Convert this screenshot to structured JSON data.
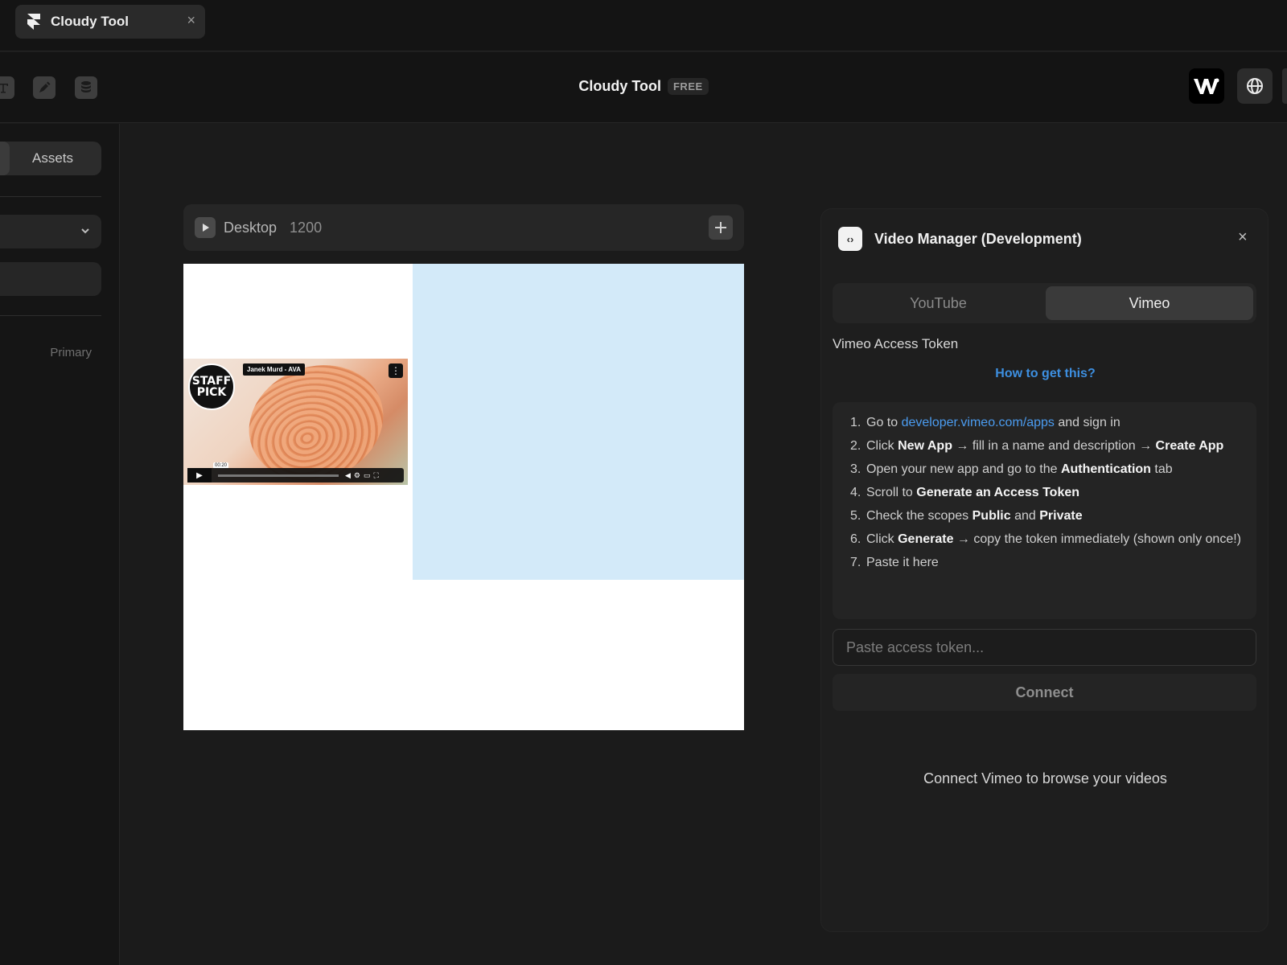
{
  "tab": {
    "title": "Cloudy Tool",
    "close_glyph": "×",
    "icon": "framer-logo-icon"
  },
  "toolbar": {
    "title": "Cloudy Tool",
    "plan_badge": "FREE",
    "tools": [
      "text-icon",
      "pen-tool-icon",
      "database-icon"
    ],
    "right_buttons": [
      "w-logo-icon",
      "globe-icon"
    ]
  },
  "sidebar": {
    "assets_tab": "Assets",
    "primary_label": "Primary"
  },
  "canvas": {
    "breakpoint_name": "Desktop",
    "breakpoint_width": "1200",
    "video": {
      "badge_text_line1": "STAFF",
      "badge_text_line2": "PICK",
      "title": "Janek Murd - AVA",
      "time": "00:20"
    },
    "colors": {
      "blue_box": "#d3eaf9",
      "frame": "#ffffff"
    }
  },
  "panel": {
    "title": "Video Manager (Development)",
    "close_glyph": "×",
    "tabs": [
      "YouTube",
      "Vimeo"
    ],
    "active_tab": "Vimeo",
    "token_label": "Vimeo Access Token",
    "howto_link": "How to get this?",
    "steps": [
      {
        "n": "1.",
        "parts": [
          [
            "t",
            "Go to "
          ],
          [
            "a",
            "developer.vimeo.com/apps"
          ],
          [
            "t",
            " and sign in"
          ]
        ]
      },
      {
        "n": "2.",
        "parts": [
          [
            "t",
            "Click "
          ],
          [
            "b",
            "New App"
          ],
          [
            "t",
            " → fill in a name and description → "
          ],
          [
            "b",
            "Create App"
          ]
        ]
      },
      {
        "n": "3.",
        "parts": [
          [
            "t",
            "Open your new app and go to the "
          ],
          [
            "b",
            "Authentication"
          ],
          [
            "t",
            " tab"
          ]
        ]
      },
      {
        "n": "4.",
        "parts": [
          [
            "t",
            "Scroll to "
          ],
          [
            "b",
            "Generate an Access Token"
          ]
        ]
      },
      {
        "n": "5.",
        "parts": [
          [
            "t",
            "Check the scopes "
          ],
          [
            "b",
            "Public"
          ],
          [
            "t",
            " and "
          ],
          [
            "b",
            "Private"
          ]
        ]
      },
      {
        "n": "6.",
        "parts": [
          [
            "t",
            "Click "
          ],
          [
            "b",
            "Generate"
          ],
          [
            "t",
            " → copy the token immediately (shown only once!)"
          ]
        ]
      },
      {
        "n": "7.",
        "parts": [
          [
            "t",
            "Paste it here"
          ]
        ]
      }
    ],
    "input_placeholder": "Paste access token...",
    "input_value": "",
    "connect_label": "Connect",
    "empty_message": "Connect Vimeo to browse your videos",
    "link_color": "#3d8fe0"
  }
}
